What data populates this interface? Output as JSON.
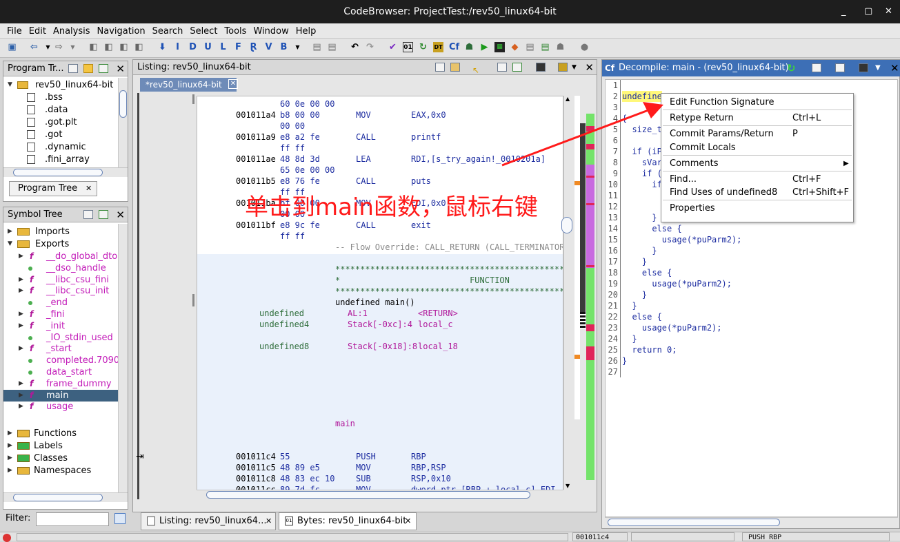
{
  "window": {
    "title": "CodeBrowser: ProjectTest:/rev50_linux64-bit",
    "controls": [
      "_",
      "▢",
      "✕"
    ]
  },
  "menu": [
    "File",
    "Edit",
    "Analysis",
    "Navigation",
    "Search",
    "Select",
    "Tools",
    "Window",
    "Help"
  ],
  "program_tree": {
    "title": "Program Tr...",
    "root": "rev50_linux64-bit",
    "items": [
      ".bss",
      ".data",
      ".got.plt",
      ".got",
      ".dynamic",
      ".fini_array"
    ],
    "tab": "Program Tree"
  },
  "symbol_tree": {
    "title": "Symbol Tree",
    "imports": "Imports",
    "exports": "Exports",
    "exports_items": [
      {
        "name": "__do_global_dtors_",
        "kind": "func"
      },
      {
        "name": "__dso_handle",
        "kind": "data"
      },
      {
        "name": "__libc_csu_fini",
        "kind": "func"
      },
      {
        "name": "__libc_csu_init",
        "kind": "func"
      },
      {
        "name": "_end",
        "kind": "data"
      },
      {
        "name": "_fini",
        "kind": "func"
      },
      {
        "name": "_init",
        "kind": "func"
      },
      {
        "name": "_IO_stdin_used",
        "kind": "data"
      },
      {
        "name": "_start",
        "kind": "func"
      },
      {
        "name": "completed.7090",
        "kind": "data"
      },
      {
        "name": "data_start",
        "kind": "data"
      },
      {
        "name": "frame_dummy",
        "kind": "func"
      },
      {
        "name": "main",
        "kind": "func"
      },
      {
        "name": "usage",
        "kind": "func"
      }
    ],
    "groups": [
      "Functions",
      "Labels",
      "Classes",
      "Namespaces"
    ],
    "filter_label": "Filter:",
    "filter_value": ""
  },
  "listing": {
    "title": "Listing:  rev50_linux64-bit",
    "tab": "*rev50_linux64-bit",
    "lines": [
      {
        "addr": "",
        "bytes": "60 0e 00 00",
        "mn": "",
        "op": ""
      },
      {
        "addr": "001011a4",
        "bytes": "b8 00 00",
        "mn": "MOV",
        "op": "EAX,0x0"
      },
      {
        "addr": "",
        "bytes": "00 00",
        "mn": "",
        "op": ""
      },
      {
        "addr": "001011a9",
        "bytes": "e8 a2 fe",
        "mn": "CALL",
        "op": "printf"
      },
      {
        "addr": "",
        "bytes": "ff ff",
        "mn": "",
        "op": ""
      },
      {
        "addr": "001011ae",
        "bytes": "48 8d 3d",
        "mn": "LEA",
        "op": "RDI,[s_try_again!_0010201a]"
      },
      {
        "addr": "",
        "bytes": "65 0e 00 00",
        "mn": "",
        "op": ""
      },
      {
        "addr": "001011b5",
        "bytes": "e8 76 fe",
        "mn": "CALL",
        "op": "puts"
      },
      {
        "addr": "",
        "bytes": "ff ff",
        "mn": "",
        "op": ""
      },
      {
        "addr": "001011ba",
        "bytes": "bf 00 00",
        "mn": "MOV",
        "op": "EDI,0x0"
      },
      {
        "addr": "",
        "bytes": "00 00",
        "mn": "",
        "op": ""
      },
      {
        "addr": "001011bf",
        "bytes": "e8 9c fe",
        "mn": "CALL",
        "op": "exit"
      },
      {
        "addr": "",
        "bytes": "ff ff",
        "mn": "",
        "op": ""
      }
    ],
    "flow_override": "-- Flow Override: CALL_RETURN (CALL_TERMINATOR)",
    "stars": "**************************************************",
    "function_banner": "*                          FUNCTION",
    "signature": "undefined main()",
    "vars": [
      {
        "type": "undefined",
        "loc": "AL:1",
        "name": "<RETURN>"
      },
      {
        "type": "undefined4",
        "loc": "Stack[-0xc]:4",
        "name": "local_c"
      },
      {
        "type": "undefined8",
        "loc": "Stack[-0x18]:8",
        "name": "local_18"
      }
    ],
    "label": "main",
    "code": [
      {
        "addr": "001011c4",
        "bytes": "55",
        "mn": "PUSH",
        "op": "RBP"
      },
      {
        "addr": "001011c5",
        "bytes": "48 89 e5",
        "mn": "MOV",
        "op": "RBP,RSP"
      },
      {
        "addr": "001011c8",
        "bytes": "48 83 ec 10",
        "mn": "SUB",
        "op": "RSP,0x10"
      },
      {
        "addr": "001011cc",
        "bytes": "89 7d fc",
        "mn": "MOV",
        "op": "dword ptr [RBP + local_c],EDI"
      }
    ]
  },
  "annotation": {
    "text": "单击到main函数，鼠标右键",
    "color": "#ff1a1a"
  },
  "decompile": {
    "title": "Decompile: main -  (rev50_linux64-bit)",
    "line_numbers": [
      "1",
      "2",
      "3",
      "4",
      "5",
      "6",
      "7",
      "8",
      "9",
      "10",
      "11",
      "12",
      "13",
      "14",
      "15",
      "16",
      "17",
      "18",
      "19",
      "20",
      "21",
      "22",
      "23",
      "24",
      "25",
      "26",
      "27"
    ],
    "lines": [
      "",
      "undefine",
      "",
      "{",
      "  size_t",
      "",
      "  if (iP",
      "    sVar",
      "    if (",
      "      if",
      "",
      "",
      "      }",
      "      else {",
      "        usage(*puParm2);",
      "      }",
      "    }",
      "    else {",
      "      usage(*puParm2);",
      "    }",
      "  }",
      "  else {",
      "    usage(*puParm2);",
      "  }",
      "  return 0;",
      "}",
      ""
    ]
  },
  "context_menu": {
    "groups": [
      [
        {
          "label": "Edit Function Signature",
          "key": ""
        }
      ],
      [
        {
          "label": "Retype Return",
          "key": "Ctrl+L"
        }
      ],
      [
        {
          "label": "Commit Params/Return",
          "key": "P"
        },
        {
          "label": "Commit Locals",
          "key": ""
        }
      ],
      [
        {
          "label": "Comments",
          "key": "▶"
        }
      ],
      [
        {
          "label": "Find...",
          "key": "Ctrl+F"
        },
        {
          "label": "Find Uses of undefined8",
          "key": "Ctrl+Shift+F"
        }
      ],
      [
        {
          "label": "Properties",
          "key": ""
        }
      ]
    ]
  },
  "bottom_tabs": [
    "Listing:  rev50_linux64...",
    "Bytes: rev50_linux64-bit"
  ],
  "status": {
    "addr": "001011c4",
    "text": "PUSH RBP"
  }
}
